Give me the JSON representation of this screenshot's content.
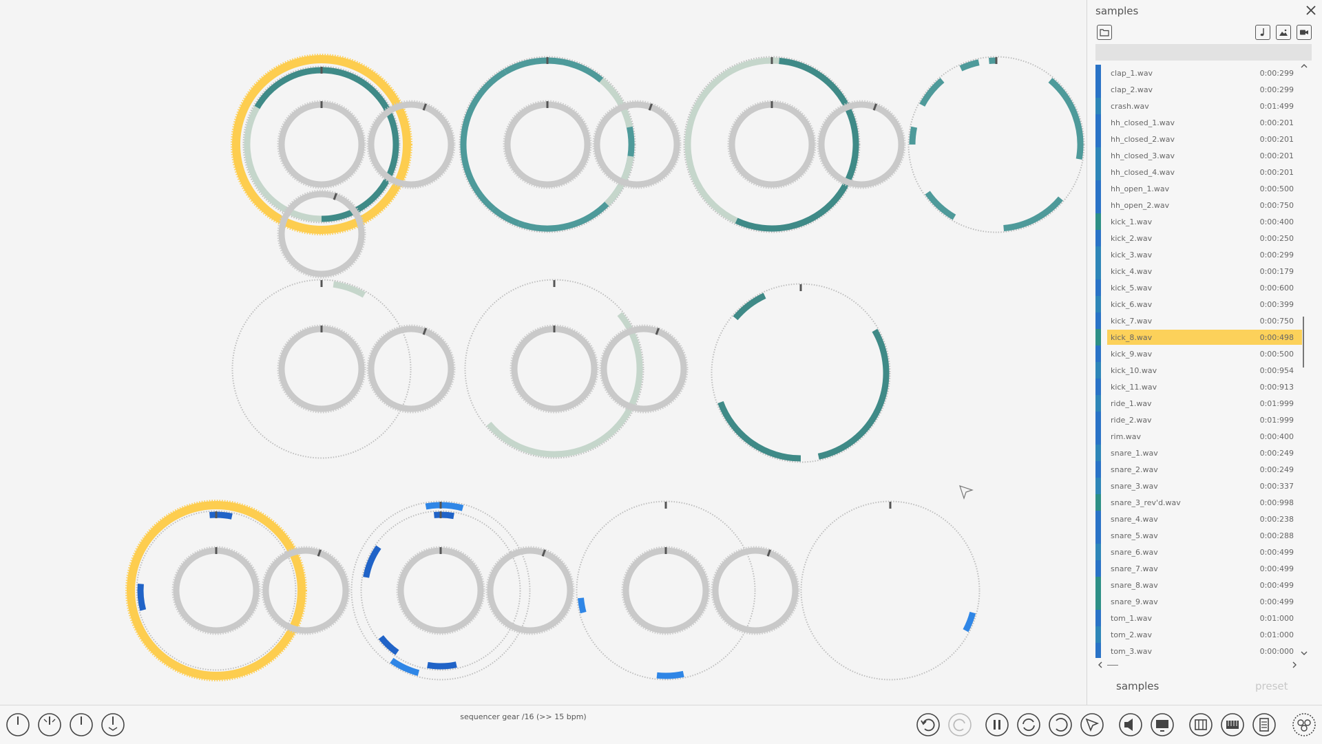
{
  "panel": {
    "title": "samples",
    "close_icon": "close-icon",
    "toolbar": {
      "folder_icon": "folder-icon",
      "music_icon": "music-note-icon",
      "image_icon": "image-icon",
      "video_icon": "video-icon"
    },
    "search_value": "",
    "samples": [
      {
        "name": "clap_1.wav",
        "duration": "0:00:299",
        "color": "#2a73c6"
      },
      {
        "name": "clap_2.wav",
        "duration": "0:00:299",
        "color": "#2a73c6"
      },
      {
        "name": "crash.wav",
        "duration": "0:01:499",
        "color": "#2e86b8"
      },
      {
        "name": "hh_closed_1.wav",
        "duration": "0:00:201",
        "color": "#2a73c6"
      },
      {
        "name": "hh_closed_2.wav",
        "duration": "0:00:201",
        "color": "#2a73c6"
      },
      {
        "name": "hh_closed_3.wav",
        "duration": "0:00:201",
        "color": "#2e86b8"
      },
      {
        "name": "hh_closed_4.wav",
        "duration": "0:00:201",
        "color": "#2e86b8"
      },
      {
        "name": "hh_open_1.wav",
        "duration": "0:00:500",
        "color": "#2a73c6"
      },
      {
        "name": "hh_open_2.wav",
        "duration": "0:00:750",
        "color": "#2a73c6"
      },
      {
        "name": "kick_1.wav",
        "duration": "0:00:400",
        "color": "#2d8f86"
      },
      {
        "name": "kick_2.wav",
        "duration": "0:00:250",
        "color": "#2a73c6"
      },
      {
        "name": "kick_3.wav",
        "duration": "0:00:299",
        "color": "#2e86b8"
      },
      {
        "name": "kick_4.wav",
        "duration": "0:00:179",
        "color": "#2e86b8"
      },
      {
        "name": "kick_5.wav",
        "duration": "0:00:600",
        "color": "#2a73c6"
      },
      {
        "name": "kick_6.wav",
        "duration": "0:00:399",
        "color": "#2e86b8"
      },
      {
        "name": "kick_7.wav",
        "duration": "0:00:750",
        "color": "#2a73c6"
      },
      {
        "name": "kick_8.wav",
        "duration": "0:00:498",
        "color": "#2d8f86",
        "selected": true
      },
      {
        "name": "kick_9.wav",
        "duration": "0:00:500",
        "color": "#2a73c6"
      },
      {
        "name": "kick_10.wav",
        "duration": "0:00:954",
        "color": "#2e86b8"
      },
      {
        "name": "kick_11.wav",
        "duration": "0:00:913",
        "color": "#2a73c6"
      },
      {
        "name": "ride_1.wav",
        "duration": "0:01:999",
        "color": "#2e86b8"
      },
      {
        "name": "ride_2.wav",
        "duration": "0:01:999",
        "color": "#2a73c6"
      },
      {
        "name": "rim.wav",
        "duration": "0:00:400",
        "color": "#2a73c6"
      },
      {
        "name": "snare_1.wav",
        "duration": "0:00:249",
        "color": "#2e86b8"
      },
      {
        "name": "snare_2.wav",
        "duration": "0:00:249",
        "color": "#2a73c6"
      },
      {
        "name": "snare_3.wav",
        "duration": "0:00:337",
        "color": "#2e86b8"
      },
      {
        "name": "snare_3_rev'd.wav",
        "duration": "0:00:998",
        "color": "#2d8f86"
      },
      {
        "name": "snare_4.wav",
        "duration": "0:00:238",
        "color": "#2a73c6"
      },
      {
        "name": "snare_5.wav",
        "duration": "0:00:288",
        "color": "#2a73c6"
      },
      {
        "name": "snare_6.wav",
        "duration": "0:00:499",
        "color": "#2e86b8"
      },
      {
        "name": "snare_7.wav",
        "duration": "0:00:499",
        "color": "#2a73c6"
      },
      {
        "name": "snare_8.wav",
        "duration": "0:00:499",
        "color": "#2d8f86"
      },
      {
        "name": "snare_9.wav",
        "duration": "0:00:499",
        "color": "#2d8f86"
      },
      {
        "name": "tom_1.wav",
        "duration": "0:01:000",
        "color": "#2a73c6"
      },
      {
        "name": "tom_2.wav",
        "duration": "0:01:000",
        "color": "#2e86b8"
      },
      {
        "name": "tom_3.wav",
        "duration": "0:00:000",
        "color": "#2a73c6"
      }
    ],
    "tabs": {
      "samples": "samples",
      "preset": "preset"
    },
    "colors": {
      "selected": "#fcd15a",
      "tab_inactive": "#c8c8c8"
    }
  },
  "status_bar": {
    "text": "sequencer gear /16 (>> 15 bpm)"
  },
  "left_buttons": [
    "power-gear-icon-1",
    "power-gear-icon-2",
    "power-gear-icon-3",
    "power-gear-icon-4"
  ],
  "right_buttons": [
    "undo-icon",
    "redo-icon",
    "pause-icon",
    "sync-icon",
    "rotate-icon",
    "pointer-icon",
    "speaker-icon",
    "monitor-icon",
    "columns-icon",
    "keyboard-icon",
    "notes-icon",
    "more-gears-icon"
  ],
  "colors": {
    "teal": "#4e9a9a",
    "teal_dark": "#3f8a87",
    "teal_light": "#c5d6cb",
    "yellow": "#fdcd4f",
    "blue": "#2f86e6",
    "blue_dark": "#2063c7",
    "gear_gray": "#c9c9c9",
    "marker": "#555555"
  }
}
